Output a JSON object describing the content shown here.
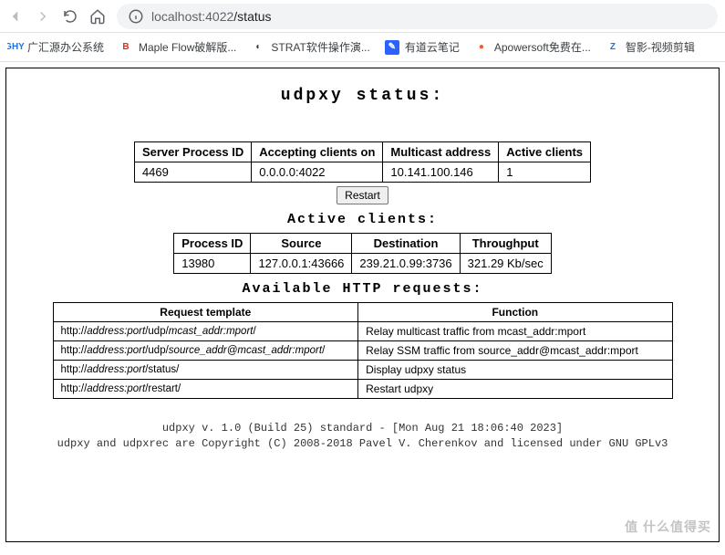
{
  "browser": {
    "url_host": "localhost:4022",
    "url_path": "/status"
  },
  "bookmarks": [
    {
      "label": "广汇源办公系统",
      "icon_text": "GHY",
      "icon_bg": "#fff",
      "icon_color": "#1a73e8"
    },
    {
      "label": "Maple Flow破解版...",
      "icon_text": "B",
      "icon_bg": "#fff",
      "icon_color": "#d93025"
    },
    {
      "label": "STRAT软件操作演...",
      "icon_text": "◐",
      "icon_bg": "#fff",
      "icon_color": "#333"
    },
    {
      "label": "有道云笔记",
      "icon_text": "✎",
      "icon_bg": "#2962ff",
      "icon_color": "#fff"
    },
    {
      "label": "Apowersoft免费在...",
      "icon_text": "●",
      "icon_bg": "#fff",
      "icon_color": "#ff5722"
    },
    {
      "label": "智影-视频剪辑",
      "icon_text": "Z",
      "icon_bg": "#fff",
      "icon_color": "#1a73e8"
    }
  ],
  "page": {
    "title": "udpxy status:",
    "server_table": {
      "headers": [
        "Server Process ID",
        "Accepting clients on",
        "Multicast address",
        "Active clients"
      ],
      "row": [
        "4469",
        "0.0.0.0:4022",
        "10.141.100.146",
        "1"
      ]
    },
    "restart_label": "Restart",
    "active_clients_heading": "Active clients:",
    "clients_table": {
      "headers": [
        "Process ID",
        "Source",
        "Destination",
        "Throughput"
      ],
      "rows": [
        [
          "13980",
          "127.0.0.1:43666",
          "239.21.0.99:3736",
          "321.29 Kb/sec"
        ]
      ]
    },
    "http_heading": "Available HTTP requests:",
    "req_table": {
      "headers": [
        "Request template",
        "Function"
      ],
      "rows": [
        {
          "tmpl_prefix": "http://",
          "tmpl_parts": [
            "address:port",
            "/udp/",
            "mcast_addr:mport",
            "/"
          ],
          "func": "Relay multicast traffic from mcast_addr:mport"
        },
        {
          "tmpl_prefix": "http://",
          "tmpl_parts": [
            "address:port",
            "/udp/",
            "source_addr@mcast_addr:mport",
            "/"
          ],
          "func": "Relay SSM traffic from source_addr@mcast_addr:mport"
        },
        {
          "tmpl_prefix": "http://",
          "tmpl_parts": [
            "address:port",
            "/status/"
          ],
          "func": "Display udpxy status"
        },
        {
          "tmpl_prefix": "http://",
          "tmpl_parts": [
            "address:port",
            "/restart/"
          ],
          "func": "Restart udpxy"
        }
      ]
    },
    "footer_line1": "udpxy v. 1.0 (Build 25) standard - [Mon Aug 21 18:06:40 2023]",
    "footer_line2": "udpxy and udpxrec are Copyright (C) 2008-2018 Pavel V. Cherenkov and licensed under GNU GPLv3",
    "watermark": "值 什么值得买"
  }
}
